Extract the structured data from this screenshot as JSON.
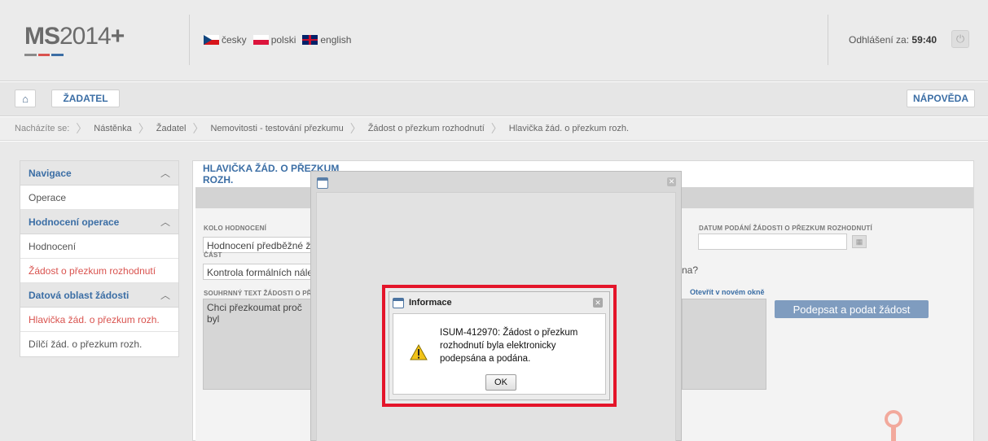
{
  "header": {
    "logo_text": "MS2014+",
    "logo_ms": "MS",
    "logo_num": "2014",
    "logo_plus": "+",
    "languages": [
      {
        "label": "česky",
        "flag": "cz-flag-icon"
      },
      {
        "label": "polski",
        "flag": "pl-flag-icon"
      },
      {
        "label": "english",
        "flag": "gb-flag-icon"
      }
    ],
    "logout_label": "Odhlášení za:",
    "logout_time": "59:40"
  },
  "navbar": {
    "home_icon": "home-icon",
    "zadatel_label": "ŽADATEL",
    "help_label": "NÁPOVĚDA"
  },
  "breadcrumb": {
    "lead": "Nacházíte se:",
    "items": [
      "Nástěnka",
      "Žadatel",
      "Nemovitosti - testování přezkumu",
      "Žádost o přezkum rozhodnutí",
      "Hlavička žád. o přezkum rozh."
    ]
  },
  "sidebar": {
    "sections": [
      {
        "title": "Navigace",
        "items": [
          "Operace"
        ]
      },
      {
        "title": "Hodnocení operace",
        "items": [
          "Hodnocení",
          "Žádost o přezkum rozhodnutí"
        ]
      },
      {
        "title": "Datová oblast žádosti",
        "items": [
          "Hlavička žád. o přezkum rozh.",
          "Dílčí žád. o přezkum rozh."
        ]
      }
    ]
  },
  "panel": {
    "title": "HLAVIČKA ŽÁD. O PŘEZKUM ROZH.",
    "kolo_label": "KOLO HODNOCENÍ",
    "kolo_value": "Hodnocení předběžné žádo",
    "cast_label": "ČÁST",
    "cast_value": "Kontrola formálních náleži",
    "souhrn_label": "SOUHRNNÝ TEXT ŽÁDOSTI O PŘEZ",
    "souhrn_value": "Chci přezkoumat proč byl",
    "datum_label": "DATUM PODÁNÍ ŽÁDOSTI O PŘEZKUM ROZHODNUTÍ",
    "partial_text": "na?",
    "link_new_window": "Otevřít v novém okně",
    "sign_button": "Podepsat a podat žádost"
  },
  "dialog": {
    "title": "Informace",
    "message": "ISUM-412970: Žádost o přezkum rozhodnutí byla elektronicky podepsána a podána.",
    "ok_label": "OK"
  },
  "colors": {
    "accent_blue": "#3b6ea5",
    "highlight_red": "#e4152a",
    "sidebar_active_red": "#d9534f",
    "sign_button": "#7f9cbf"
  }
}
